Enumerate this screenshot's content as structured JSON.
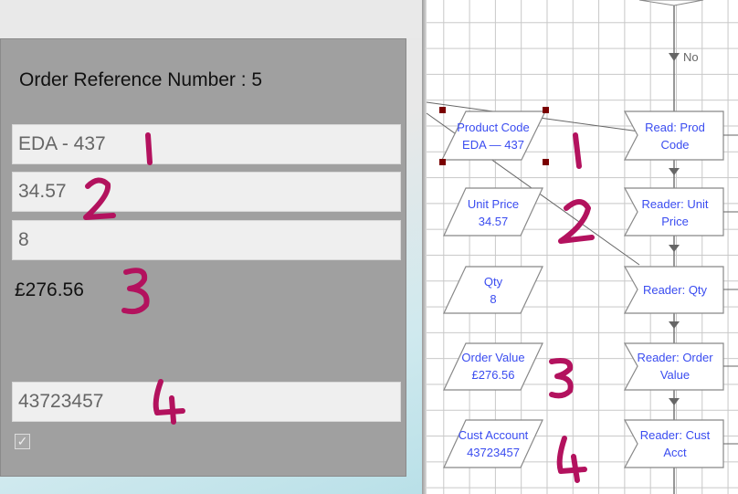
{
  "form": {
    "title": "Order Reference Number : 5",
    "product_code": "EDA - 437",
    "unit_price": "34.57",
    "quantity": "8",
    "order_value": "£276.56",
    "cust_account": "43723457",
    "checkbox_checked": true,
    "checkmark": "✓"
  },
  "flowchart": {
    "decision_no_label": "No",
    "inputs": [
      {
        "label": "Product Code",
        "value": "EDA — 437"
      },
      {
        "label": "Unit Price",
        "value": "34.57"
      },
      {
        "label": "Qty",
        "value": "8"
      },
      {
        "label": "Order Value",
        "value": "£276.56"
      },
      {
        "label": "Cust Account",
        "value": "43723457"
      }
    ],
    "steps": [
      {
        "line1": "Read: Prod",
        "line2": "Code"
      },
      {
        "line1": "Reader: Unit",
        "line2": "Price"
      },
      {
        "line1": "Reader: Qty",
        "line2": ""
      },
      {
        "line1": "Reader: Order",
        "line2": "Value"
      },
      {
        "line1": "Reader: Cust",
        "line2": "Acct"
      }
    ]
  },
  "annotations": {
    "color": "#b3125e",
    "numbers": [
      "1",
      "2",
      "3",
      "4"
    ]
  }
}
